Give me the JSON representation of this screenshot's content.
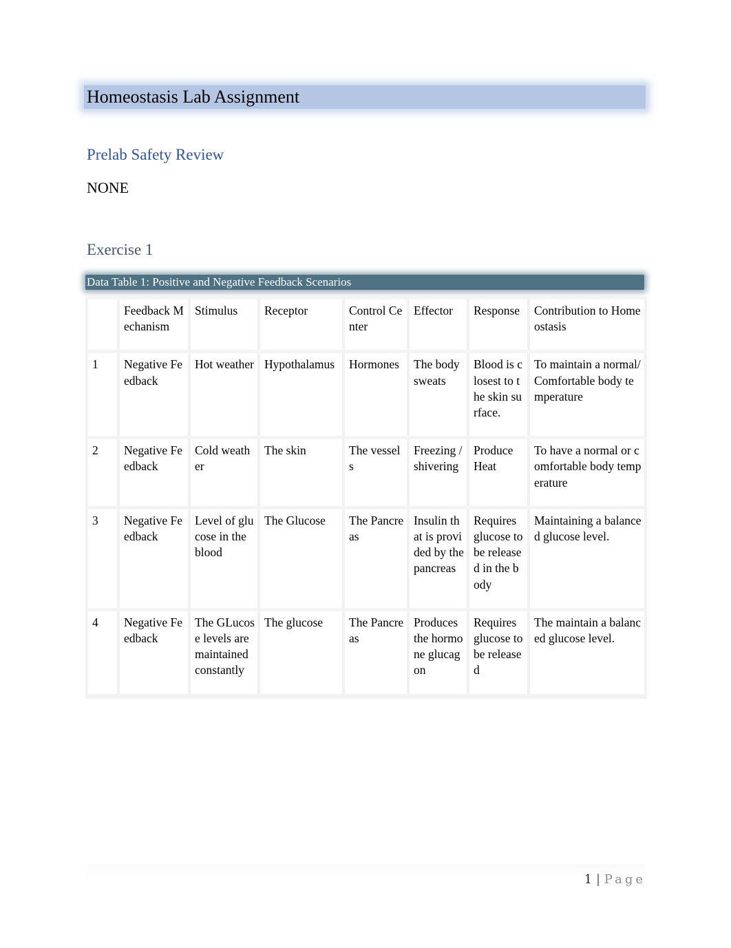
{
  "document": {
    "title": "Homeostasis Lab Assignment",
    "sections": {
      "prelab_heading": "Prelab Safety Review",
      "prelab_body": "NONE",
      "exercise_heading": "Exercise 1"
    },
    "table": {
      "caption": "Data Table 1: Positive and Negative Feedback Scenarios",
      "headers": [
        "",
        "Feedback Mechanism",
        "Stimulus",
        "Receptor",
        "Control Center",
        "Effector",
        "Response",
        "Contribution to Homeostasis"
      ],
      "rows": [
        [
          "1",
          "Negative Feedback",
          "Hot weather",
          "Hypothalamus",
          "Hormones",
          "The body sweats",
          "Blood is closest to the skin surface.",
          "To maintain a normal/Comfortable body temperature"
        ],
        [
          "2",
          "Negative Feedback",
          "Cold weather",
          "The skin",
          "The vessels",
          "Freezing / shivering",
          "Produce Heat",
          "To have a normal or comfortable body temperature"
        ],
        [
          "3",
          "Negative Feedback",
          "Level of glucose in the blood",
          "The Glucose",
          "The Pancreas",
          "Insulin that is provided by the pancreas",
          "Requires glucose to be released in the body",
          "Maintaining a balanced glucose level."
        ],
        [
          "4",
          "Negative Feedback",
          "The GLucose levels are maintained constantly",
          "The glucose",
          "The Pancreas",
          "Produces the hormone glucagon",
          "Requires glucose to be released",
          "The maintain a balanced glucose level."
        ]
      ]
    },
    "footer": {
      "page_number": "1",
      "separator": "|",
      "page_label": "Page"
    },
    "colors": {
      "title_band": "#b4c6e4",
      "heading_blue": "#2f5597",
      "heading_slate": "#44546a",
      "caption_band": "#4e7183"
    }
  }
}
